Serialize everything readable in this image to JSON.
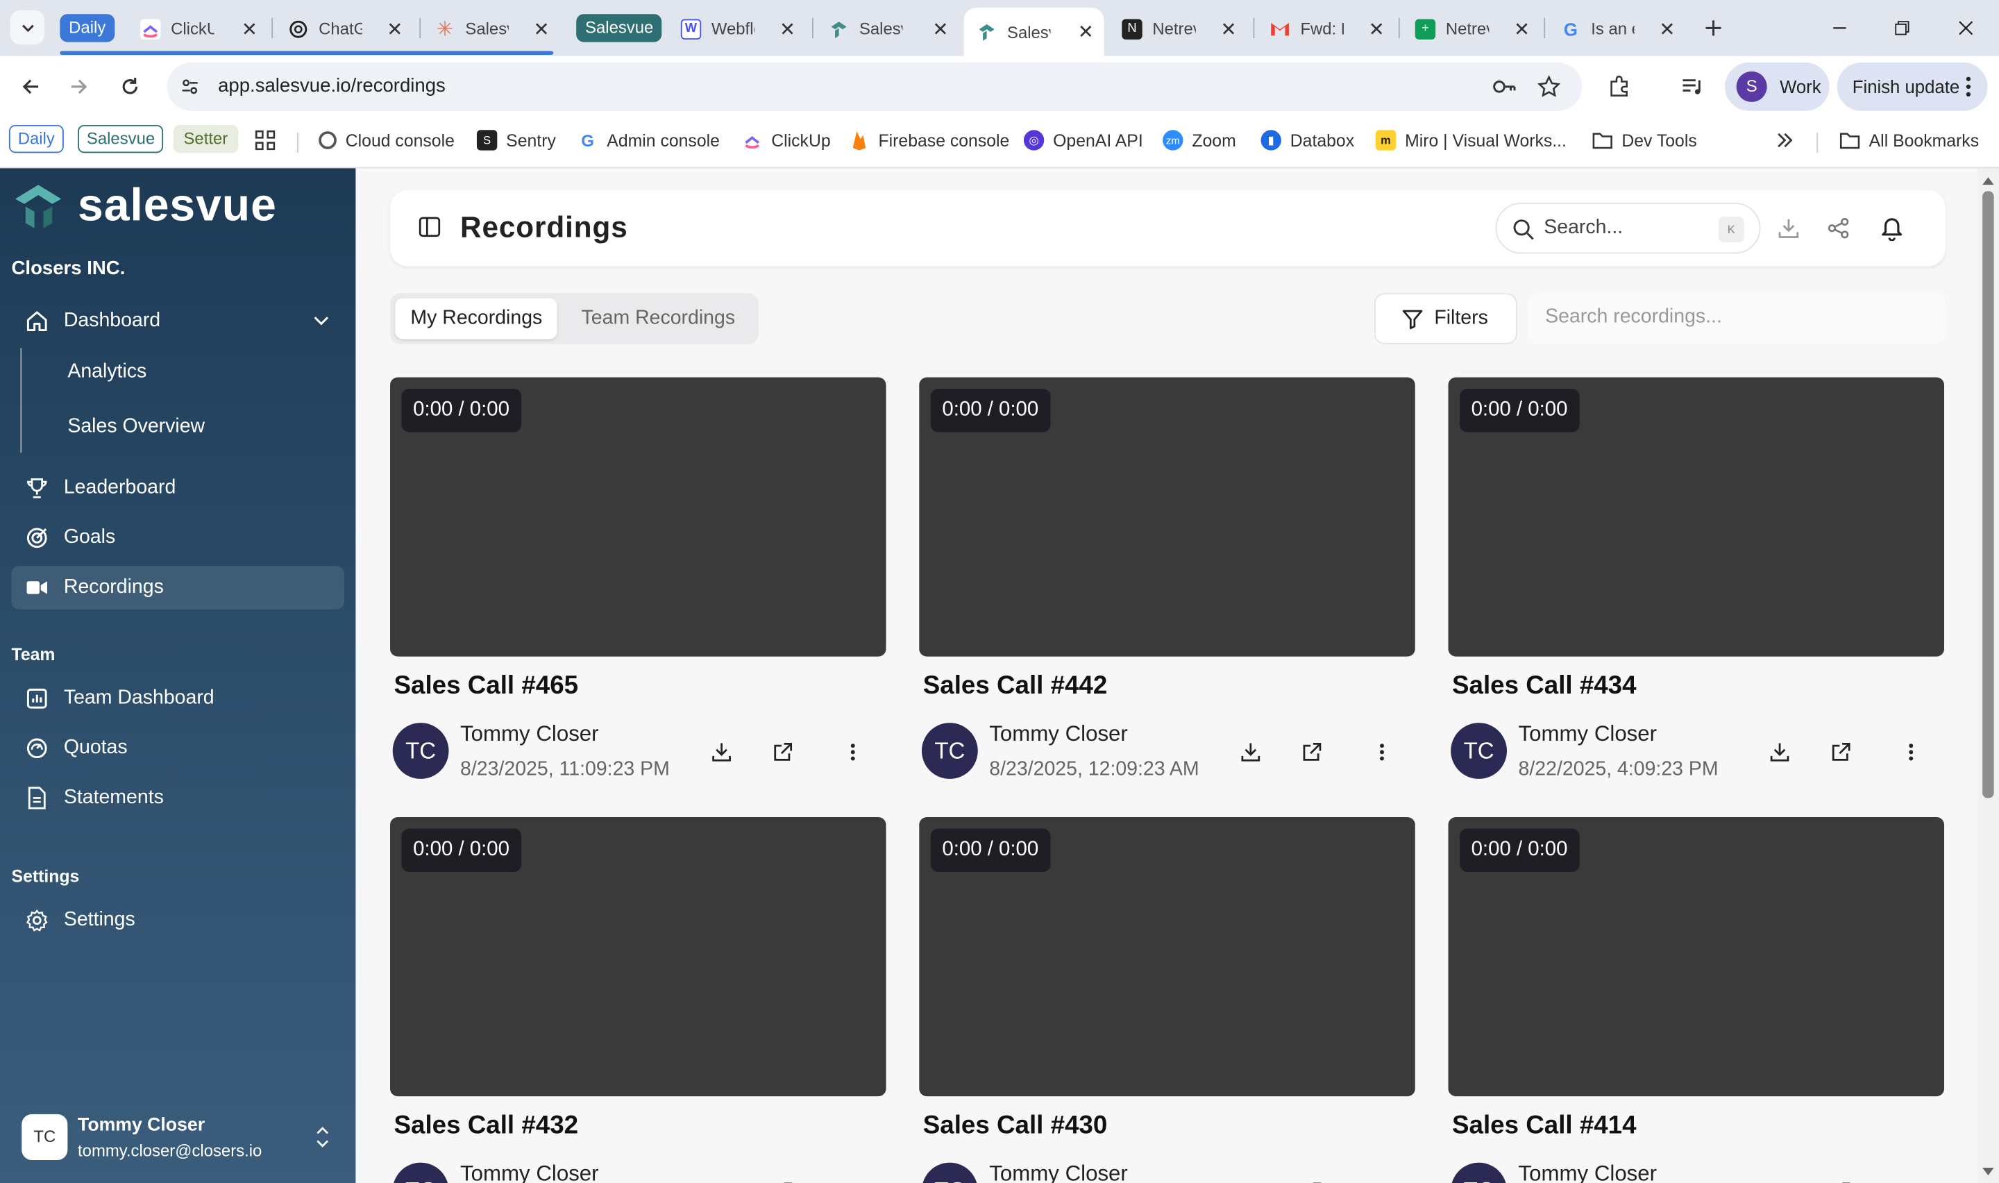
{
  "browser": {
    "tab_groups": [
      {
        "label": "Daily",
        "color": "#3b78d8"
      },
      {
        "label": "Salesvue",
        "color": "#2e6f73"
      }
    ],
    "tabs": [
      {
        "title": "ClickUp",
        "icon": "clickup-icon"
      },
      {
        "title": "ChatGPT",
        "icon": "chatgpt-icon"
      },
      {
        "title": "Salesvue",
        "icon": "claude-icon"
      },
      {
        "title": "Webflow",
        "icon": "webflow-icon"
      },
      {
        "title": "Salesvue",
        "icon": "salesvue-icon"
      },
      {
        "title": "Salesvue",
        "icon": "salesvue-icon",
        "active": true
      },
      {
        "title": "Netrev",
        "icon": "netrev-icon"
      },
      {
        "title": "Fwd: F",
        "icon": "gmail-icon"
      },
      {
        "title": "Netrev",
        "icon": "sheets-icon"
      },
      {
        "title": "Is an e",
        "icon": "google-icon"
      }
    ],
    "url": "app.salesvue.io/recordings",
    "profile_initial": "S",
    "profile_label": "Work",
    "finish_update": "Finish update",
    "bookmark_groups": [
      {
        "label": "Daily",
        "color": "#3b78d8"
      },
      {
        "label": "Salesvue",
        "color": "#2e6f73"
      },
      {
        "label": "Setter",
        "color": "#556b2f"
      }
    ],
    "bookmarks": [
      {
        "label": "Cloud console",
        "icon": "cloud-console-icon"
      },
      {
        "label": "Sentry",
        "icon": "sentry-icon"
      },
      {
        "label": "Admin console",
        "icon": "google-icon"
      },
      {
        "label": "ClickUp",
        "icon": "clickup-icon"
      },
      {
        "label": "Firebase console",
        "icon": "firebase-icon"
      },
      {
        "label": "OpenAI API",
        "icon": "openai-icon"
      },
      {
        "label": "Zoom",
        "icon": "zoom-icon"
      },
      {
        "label": "Databox",
        "icon": "databox-icon"
      },
      {
        "label": "Miro | Visual Works...",
        "icon": "miro-icon"
      },
      {
        "label": "Dev Tools",
        "icon": "folder-icon"
      }
    ],
    "all_bookmarks": "All Bookmarks",
    "colors": {
      "accent": "#2b4c69",
      "tabstrip": "#e1e5ed"
    }
  },
  "app": {
    "brand": "salesvue",
    "org": "Closers INC.",
    "nav": {
      "dashboard": "Dashboard",
      "analytics": "Analytics",
      "sales_overview": "Sales Overview",
      "leaderboard": "Leaderboard",
      "goals": "Goals",
      "recordings": "Recordings"
    },
    "team_section": "Team",
    "team_nav": {
      "team_dashboard": "Team Dashboard",
      "quotas": "Quotas",
      "statements": "Statements"
    },
    "settings_section": "Settings",
    "settings_nav": {
      "settings": "Settings"
    },
    "user": {
      "initials": "TC",
      "name": "Tommy Closer",
      "email": "tommy.closer@closers.io"
    }
  },
  "page": {
    "title": "Recordings",
    "search_placeholder": "Search...",
    "search_shortcut": "K",
    "tabs": {
      "mine": "My Recordings",
      "team": "Team Recordings"
    },
    "filters_label": "Filters",
    "recordings_search_placeholder": "Search recordings..."
  },
  "recordings": [
    {
      "title": "Sales Call #465",
      "duration": "0:00 / 0:00",
      "owner_initials": "TC",
      "owner": "Tommy Closer",
      "date": "8/23/2025, 11:09:23 PM"
    },
    {
      "title": "Sales Call #442",
      "duration": "0:00 / 0:00",
      "owner_initials": "TC",
      "owner": "Tommy Closer",
      "date": "8/23/2025, 12:09:23 AM"
    },
    {
      "title": "Sales Call #434",
      "duration": "0:00 / 0:00",
      "owner_initials": "TC",
      "owner": "Tommy Closer",
      "date": "8/22/2025, 4:09:23 PM"
    },
    {
      "title": "Sales Call #432",
      "duration": "0:00 / 0:00",
      "owner_initials": "TC",
      "owner": "Tommy Closer",
      "date": ""
    },
    {
      "title": "Sales Call #430",
      "duration": "0:00 / 0:00",
      "owner_initials": "TC",
      "owner": "Tommy Closer",
      "date": ""
    },
    {
      "title": "Sales Call #414",
      "duration": "0:00 / 0:00",
      "owner_initials": "TC",
      "owner": "Tommy Closer",
      "date": ""
    }
  ]
}
